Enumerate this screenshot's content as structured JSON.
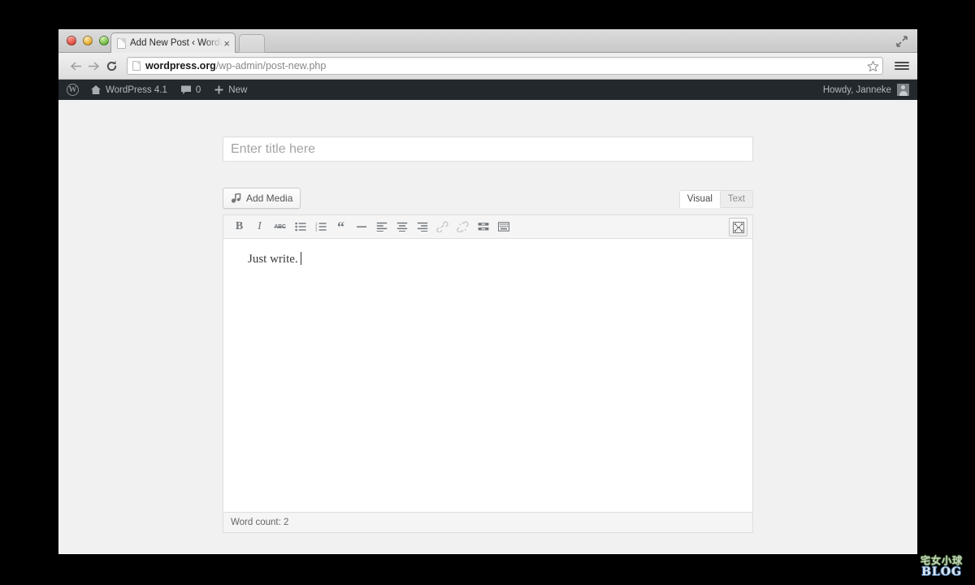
{
  "browser": {
    "window_controls": [
      "close",
      "minimize",
      "zoom"
    ],
    "tab": {
      "title": "Add New Post ‹ WordPress",
      "favicon": "page-icon",
      "close_label": "×"
    },
    "new_tab_label": "",
    "maximize_icon": "maximize-arrows-icon",
    "nav": {
      "back_icon": "←",
      "forward_icon": "→",
      "reload_icon": "⟳"
    },
    "url": {
      "domain": "wordpress.org",
      "path": "/wp-admin/post-new.php",
      "page_icon": "page-icon",
      "bookmark_icon": "star-icon"
    },
    "menu_icon": "hamburger-menu-icon"
  },
  "adminbar": {
    "logo_glyph": "W",
    "site_name": "WordPress 4.1",
    "home_icon": "home-icon",
    "comments_icon": "comment-bubble-icon",
    "comments_count": "0",
    "new_icon": "+",
    "new_label": "New",
    "greeting": "Howdy, Janneke",
    "avatar_icon": "avatar-icon"
  },
  "post": {
    "title_placeholder": "Enter title here",
    "title_value": "",
    "add_media_label": "Add Media",
    "add_media_icon": "media-icon",
    "editor_tabs": [
      {
        "label": "Visual",
        "active": true
      },
      {
        "label": "Text",
        "active": false
      }
    ],
    "toolbar_buttons": [
      {
        "name": "bold-icon",
        "label": "B",
        "disabled": false
      },
      {
        "name": "italic-icon",
        "label": "I",
        "disabled": false
      },
      {
        "name": "strikethrough-icon",
        "label": "ABC",
        "disabled": false
      },
      {
        "name": "unordered-list-icon",
        "label": "",
        "disabled": false
      },
      {
        "name": "ordered-list-icon",
        "label": "",
        "disabled": false
      },
      {
        "name": "blockquote-icon",
        "label": "“",
        "disabled": false
      },
      {
        "name": "horizontal-rule-icon",
        "label": "—",
        "disabled": false
      },
      {
        "name": "align-left-icon",
        "label": "",
        "disabled": false
      },
      {
        "name": "align-center-icon",
        "label": "",
        "disabled": false
      },
      {
        "name": "align-right-icon",
        "label": "",
        "disabled": false
      },
      {
        "name": "link-icon",
        "label": "",
        "disabled": true
      },
      {
        "name": "unlink-icon",
        "label": "",
        "disabled": true
      },
      {
        "name": "read-more-icon",
        "label": "",
        "disabled": false
      },
      {
        "name": "toggle-toolbar-icon",
        "label": "",
        "disabled": false
      }
    ],
    "fullscreen_icon": "distraction-free-writing-icon",
    "content_text": "Just write.",
    "word_count_label": "Word count: 2"
  },
  "watermark": {
    "cjk_text": "宅女小球",
    "blog_text": "BLOG"
  },
  "colors": {
    "adminbar_bg": "#23282d",
    "wp_body_bg": "#f1f1f1",
    "panel_border": "#dedede",
    "accent_text": "#555555",
    "desktop_bg": "#000000"
  }
}
